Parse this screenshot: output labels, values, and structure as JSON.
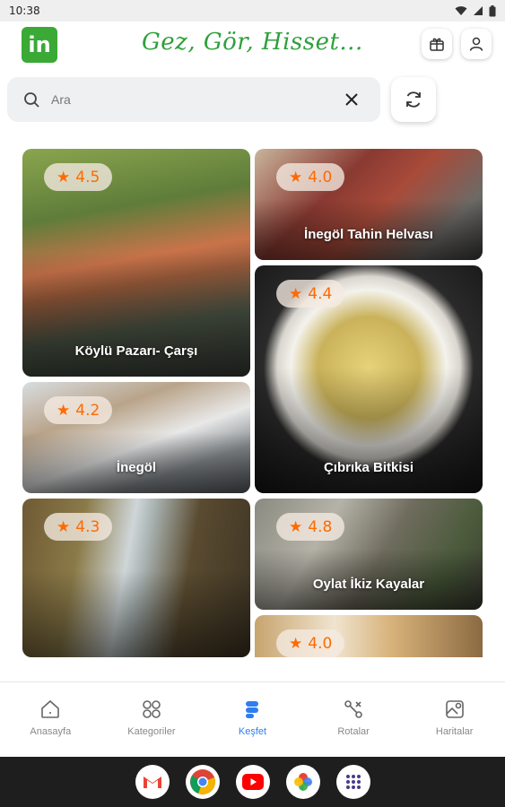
{
  "status_bar": {
    "time": "10:38"
  },
  "header": {
    "logo_text": "in",
    "slogan": "Gez, Gör, Hisset..."
  },
  "search": {
    "placeholder": "Ara"
  },
  "cards": [
    {
      "title": "Köylü Pazarı- Çarşı",
      "rating": "4.5"
    },
    {
      "title": "İnegöl Tahin Helvası",
      "rating": "4.0"
    },
    {
      "title": "Çıbrıka Bitkisi",
      "rating": "4.4"
    },
    {
      "title": "İnegöl",
      "rating": "4.2"
    },
    {
      "title": "",
      "rating": "4.3"
    },
    {
      "title": "Oylat İkiz Kayalar",
      "rating": "4.8"
    },
    {
      "title": "",
      "rating": "4.0"
    }
  ],
  "bottom_nav": [
    {
      "label": "Anasayfa",
      "icon": "home-icon"
    },
    {
      "label": "Kategoriler",
      "icon": "grid-icon"
    },
    {
      "label": "Keşfet",
      "icon": "explore-icon",
      "active": true
    },
    {
      "label": "Rotalar",
      "icon": "route-icon"
    },
    {
      "label": "Haritalar",
      "icon": "map-icon"
    }
  ],
  "dock_apps": [
    "gmail-icon",
    "chrome-icon",
    "youtube-icon",
    "photos-icon",
    "app-drawer-icon"
  ],
  "colors": {
    "brand_green": "#3aa935",
    "rating_orange": "#ff6a00",
    "active_blue": "#2f7ef0"
  }
}
